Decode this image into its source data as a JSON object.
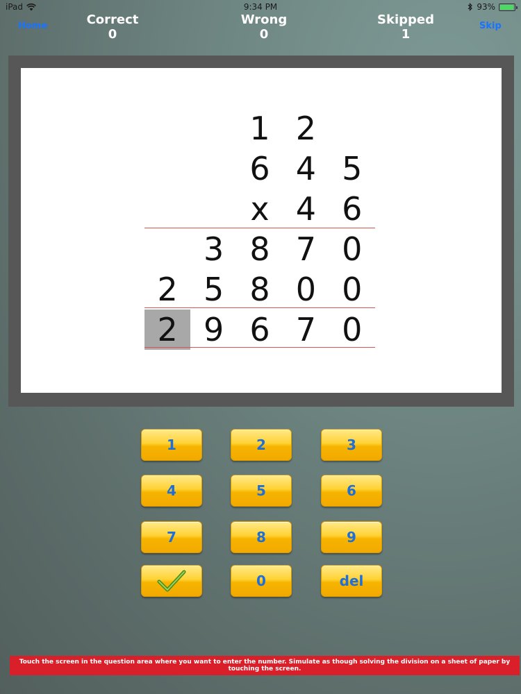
{
  "status_bar": {
    "device": "iPad",
    "time": "9:34 PM",
    "battery_percent": "93%",
    "battery_level": 0.93
  },
  "header": {
    "home_label": "Home",
    "skip_label": "Skip",
    "correct_label": "Correct",
    "correct_value": "0",
    "wrong_label": "Wrong",
    "wrong_value": "0",
    "skipped_label": "Skipped",
    "skipped_value": "1"
  },
  "problem": {
    "rows": [
      [
        "",
        "",
        "1",
        "2",
        ""
      ],
      [
        "",
        "",
        "6",
        "4",
        "5"
      ],
      [
        "",
        "",
        "x",
        "4",
        "6"
      ],
      [
        "",
        "3",
        "8",
        "7",
        "0"
      ],
      [
        "2",
        "5",
        "8",
        "0",
        "0"
      ],
      [
        "2",
        "9",
        "6",
        "7",
        "0"
      ]
    ],
    "active_cell": {
      "row": 5,
      "col": 0
    }
  },
  "keypad": {
    "keys": [
      "1",
      "2",
      "3",
      "4",
      "5",
      "6",
      "7",
      "8",
      "9",
      "",
      "0",
      "del"
    ]
  },
  "instruction": "Touch the screen in the question area where you want to enter the number. Simulate as though solving the division on a sheet of paper by touching the screen.",
  "colors": {
    "key_text": "#1e6fd9",
    "instruction_bg": "#d9202a",
    "rule": "#d9534f",
    "nav_link": "#1874ff"
  }
}
